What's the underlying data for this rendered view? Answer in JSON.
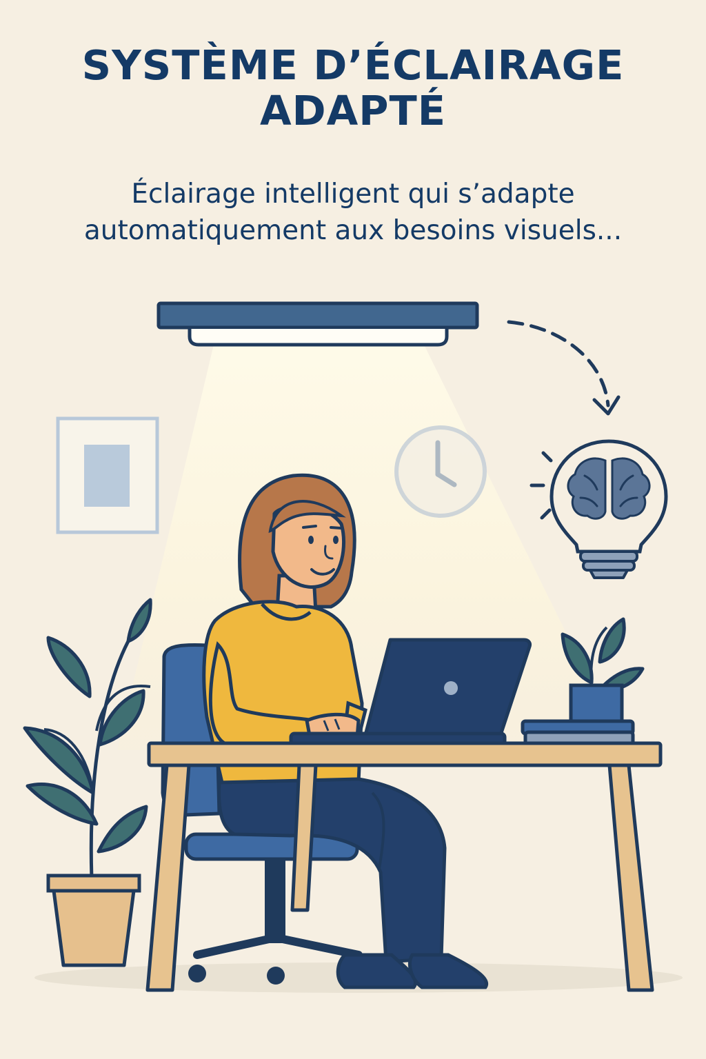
{
  "poster": {
    "title_line1": "SYSTÈME D’ÉCLAIRAGE",
    "title_line2": "ADAPTÉ",
    "subtitle_line1": "Éclairage intelligent qui s’adapte",
    "subtitle_line2": "automatiquement aux besoins visuels..."
  },
  "icons": {
    "ceiling_light": "ceiling-light-icon",
    "smart_bulb": "brain-lightbulb-icon",
    "wall_clock": "clock-icon",
    "laptop": "laptop-icon"
  },
  "colors": {
    "background": "#f6efe2",
    "navy": "#143a66",
    "sweater": "#efb83e",
    "chair": "#3e6aa3",
    "desk": "#e7c38f",
    "leaf": "#3f6f72"
  }
}
